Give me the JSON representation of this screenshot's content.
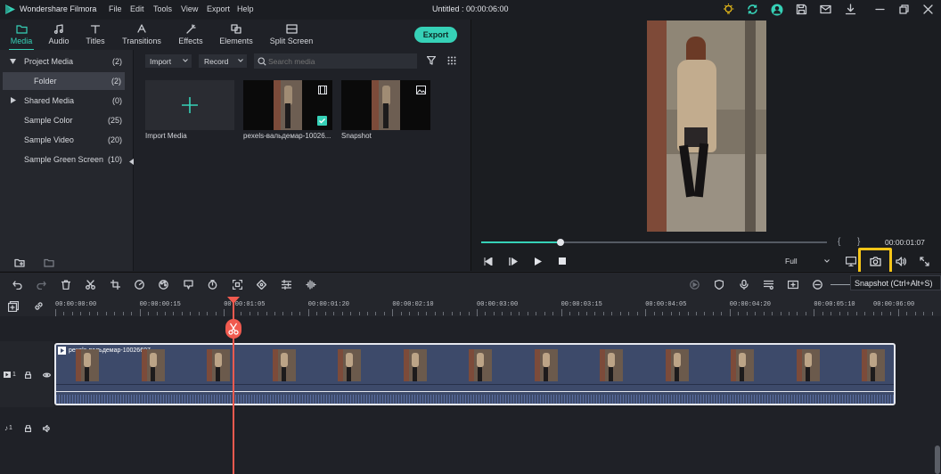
{
  "app": {
    "name": "Wondershare Filmora",
    "window_title": "Untitled : 00:00:06:00"
  },
  "menu": [
    "File",
    "Edit",
    "Tools",
    "View",
    "Export",
    "Help"
  ],
  "tabs": [
    {
      "label": "Media",
      "icon": "folder-icon",
      "active": true
    },
    {
      "label": "Audio",
      "icon": "music-note-icon"
    },
    {
      "label": "Titles",
      "icon": "text-icon"
    },
    {
      "label": "Transitions",
      "icon": "transition-icon"
    },
    {
      "label": "Effects",
      "icon": "effects-icon"
    },
    {
      "label": "Elements",
      "icon": "elements-icon"
    },
    {
      "label": "Split Screen",
      "icon": "split-screen-icon"
    }
  ],
  "export_label": "Export",
  "tree": [
    {
      "label": "Project Media",
      "count": "(2)"
    },
    {
      "label": "Folder",
      "count": "(2)"
    },
    {
      "label": "Shared Media",
      "count": "(0)"
    },
    {
      "label": "Sample Color",
      "count": "(25)"
    },
    {
      "label": "Sample Video",
      "count": "(20)"
    },
    {
      "label": "Sample Green Screen",
      "count": "(10)"
    }
  ],
  "media_toolbar": {
    "import": "Import",
    "record": "Record",
    "search_placeholder": "Search media"
  },
  "media_items": [
    {
      "caption": "Import Media"
    },
    {
      "caption": "pexels-вальдемар-10026..."
    },
    {
      "caption": "Snapshot"
    }
  ],
  "preview": {
    "timecode": "00:00:01:07",
    "quality": "Full",
    "progress": 0.23,
    "tooltip": "Snapshot (Ctrl+Alt+S)"
  },
  "ruler": [
    "00:00:00:00",
    "00:00:00:15",
    "00:00:01:05",
    "00:00:01:20",
    "00:00:02:10",
    "00:00:03:00",
    "00:00:03:15",
    "00:00:04:05",
    "00:00:04:20",
    "00:00:05:10",
    "00:00:06:00"
  ],
  "clip": {
    "title": "pexels-вальдемар-10026607"
  },
  "tracks": {
    "video_num": "1",
    "audio_num": "1"
  },
  "colors": {
    "accent": "#36d1b7",
    "playhead": "#f05a4f",
    "highlight": "#f5c518"
  }
}
